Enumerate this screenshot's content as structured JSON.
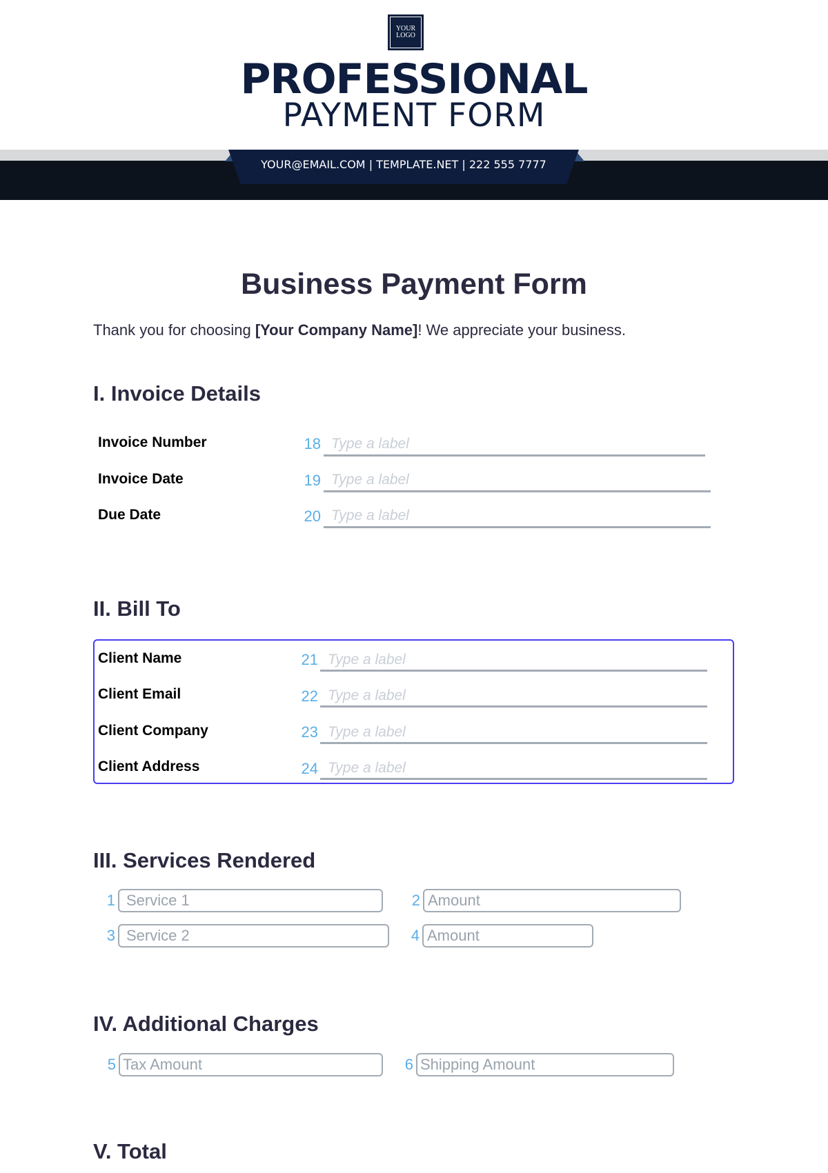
{
  "header": {
    "logo_line1": "YOUR",
    "logo_line2": "LOGO",
    "brand_title": "PROFESSIONAL",
    "brand_subtitle": "PAYMENT FORM",
    "contact_banner": "YOUR@EMAIL.COM | TEMPLATE.NET | 222 555 7777",
    "colors": {
      "navy": "#0e1d3e",
      "dark_band": "#0d131c",
      "grey_band": "#d8d9db",
      "accent_triangle": "#2d4d78"
    }
  },
  "document": {
    "title": "Business Payment Form",
    "intro_before": "Thank you for choosing ",
    "intro_bold": "[Your Company Name]",
    "intro_after": "! We appreciate your business."
  },
  "sections": {
    "invoice": {
      "heading": "I. Invoice Details",
      "fields": [
        {
          "label": "Invoice Number",
          "number": "18",
          "placeholder": "Type a label"
        },
        {
          "label": "Invoice Date",
          "number": "19",
          "placeholder": "Type a label"
        },
        {
          "label": "Due Date",
          "number": "20",
          "placeholder": "Type a label"
        }
      ]
    },
    "bill_to": {
      "heading": "II. Bill To",
      "fields": [
        {
          "label": "Client Name",
          "number": "21",
          "placeholder": "Type a label"
        },
        {
          "label": "Client Email",
          "number": "22",
          "placeholder": "Type a label"
        },
        {
          "label": "Client Company",
          "number": "23",
          "placeholder": "Type a label"
        },
        {
          "label": "Client Address",
          "number": "24",
          "placeholder": "Type a label"
        }
      ]
    },
    "services": {
      "heading": "III. Services Rendered",
      "inputs": [
        {
          "number": "1",
          "placeholder": "Service 1"
        },
        {
          "number": "2",
          "placeholder": "Amount"
        },
        {
          "number": "3",
          "placeholder": "Service 2"
        },
        {
          "number": "4",
          "placeholder": "Amount"
        }
      ]
    },
    "additional": {
      "heading": "IV. Additional Charges",
      "inputs": [
        {
          "number": "5",
          "placeholder": "Tax Amount"
        },
        {
          "number": "6",
          "placeholder": "Shipping Amount"
        }
      ]
    },
    "total": {
      "heading": "V. Total"
    }
  },
  "colors": {
    "heading_text": "#2b2a40",
    "field_number": "#5aaee8",
    "placeholder": "#c9ced6",
    "underline": "#a3abb4",
    "focus_border": "#4a3cf2"
  }
}
